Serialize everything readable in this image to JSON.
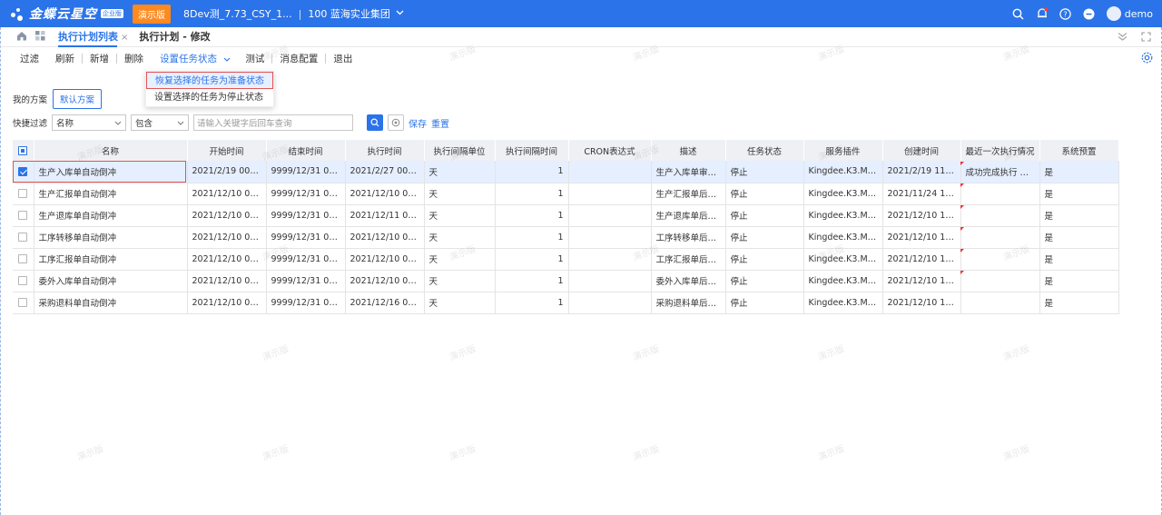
{
  "app": {
    "logo_text": "金蝶云星空",
    "edition_badge": "企业版",
    "demo_badge": "演示版",
    "database": "8Dev测_7.73_CSY_1...",
    "separator": "|",
    "org": "100 蓝海实业集团",
    "user": "demo"
  },
  "tabs": [
    {
      "label": "执行计划列表",
      "close": "×"
    },
    {
      "label": "执行计划 - 修改"
    }
  ],
  "toolbar": {
    "filter": "过滤",
    "refresh": "刷新",
    "new": "新增",
    "delete": "删除",
    "set_status": "设置任务状态",
    "test": "测试",
    "msg_config": "消息配置",
    "exit": "退出"
  },
  "dropdown": {
    "items": [
      "恢复选择的任务为准备状态",
      "设置选择的任务为停止状态"
    ]
  },
  "scheme": {
    "label": "我的方案",
    "default_btn": "默认方案"
  },
  "quick_filter": {
    "label": "快捷过滤",
    "field": "名称",
    "operator": "包含",
    "placeholder": "请输入关键字后回车查询",
    "save": "保存",
    "reset": "重置"
  },
  "grid": {
    "columns": [
      "名称",
      "开始时间",
      "结束时间",
      "执行时间",
      "执行间隔单位",
      "执行间隔时间",
      "CRON表达式",
      "描述",
      "任务状态",
      "服务插件",
      "创建时间",
      "最近一次执行情况",
      "系统预置"
    ],
    "rows": [
      {
        "checked": true,
        "cells": [
          "生产入库单自动倒冲",
          "2021/2/19 00:00:...",
          "9999/12/31 00:0...",
          "2021/2/27 00:00:...",
          "天",
          "1",
          "",
          "生产入库单审核自...",
          "停止",
          "Kingdee.K3.MFG....",
          "2021/2/19 11:02:...",
          "成功完成执行  开...",
          "是"
        ]
      },
      {
        "checked": false,
        "cells": [
          "生产汇报单自动倒冲",
          "2021/12/10 00:0...",
          "9999/12/31 00:0...",
          "2021/12/10 00:0...",
          "天",
          "1",
          "",
          "生产汇报单后台自...",
          "停止",
          "Kingdee.K3.MFG....",
          "2021/11/24 14:1...",
          "",
          "是"
        ]
      },
      {
        "checked": false,
        "cells": [
          "生产退库单自动倒冲",
          "2021/12/10 00:0...",
          "9999/12/31 00:0...",
          "2021/12/11 00:0...",
          "天",
          "1",
          "",
          "生产退库单后台自...",
          "停止",
          "Kingdee.K3.MFG....",
          "2021/12/10 14:0...",
          "",
          "是"
        ]
      },
      {
        "checked": false,
        "cells": [
          "工序转移单自动倒冲",
          "2021/12/10 00:0...",
          "9999/12/31 00:0...",
          "2021/12/10 00:0...",
          "天",
          "1",
          "",
          "工序转移单后台自...",
          "停止",
          "Kingdee.K3.MFG....",
          "2021/12/10 14:0...",
          "",
          "是"
        ]
      },
      {
        "checked": false,
        "cells": [
          "工序汇报单自动倒冲",
          "2021/12/10 00:0...",
          "9999/12/31 00:0...",
          "2021/12/10 00:0...",
          "天",
          "1",
          "",
          "工序汇报单后台自...",
          "停止",
          "Kingdee.K3.MFG....",
          "2021/12/10 14:0...",
          "",
          "是"
        ]
      },
      {
        "checked": false,
        "cells": [
          "委外入库单自动倒冲",
          "2021/12/10 00:0...",
          "9999/12/31 00:0...",
          "2021/12/10 00:0...",
          "天",
          "1",
          "",
          "委外入库单后台自...",
          "停止",
          "Kingdee.K3.MFG....",
          "2021/12/10 14:1...",
          "",
          "是"
        ]
      },
      {
        "checked": false,
        "cells": [
          "采购退料单自动倒冲",
          "2021/12/10 00:0...",
          "9999/12/31 00:0...",
          "2021/12/16 00:0...",
          "天",
          "1",
          "",
          "采购退料单后台自...",
          "停止",
          "Kingdee.K3.MFG....",
          "2021/12/10 14:1...",
          "",
          "是"
        ]
      }
    ]
  },
  "watermark": "演示版",
  "colors": {
    "brand": "#2b73e8",
    "demo": "#ff8a1f",
    "highlight": "#e35454"
  }
}
